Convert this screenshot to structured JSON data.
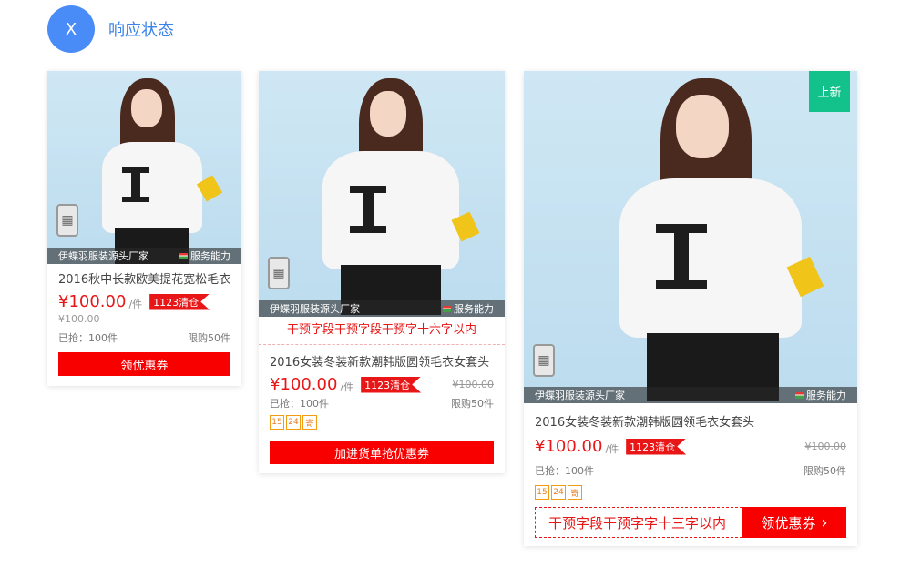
{
  "header": {
    "avatar_letter": "X",
    "title": "响应状态"
  },
  "shop": {
    "name": "伊蝶羽服装源头厂家",
    "service_label": "服务能力"
  },
  "cards": [
    {
      "product_name": "2016秋中长款欧美提花宽松毛衣",
      "price": "¥100.00",
      "unit": "/件",
      "stock_badge": "1123清仓",
      "old_price": "¥100.00",
      "sold": "已抢：100件",
      "limit": "限购50件",
      "coupon_button": "领优惠券"
    },
    {
      "notice": "干预字段干预字段干预字十六字以内",
      "product_name": "2016女装冬装新款潮韩版圆领毛衣女套头",
      "price": "¥100.00",
      "unit": "/件",
      "stock_badge": "1123清仓",
      "old_price": "¥100.00",
      "sold": "已抢：100件",
      "limit": "限购50件",
      "tags": [
        "15",
        "24",
        "寄"
      ],
      "cart_button": "加进货单抢优惠券"
    },
    {
      "ribbon": "上新",
      "product_name": "2016女装冬装新款潮韩版圆领毛衣女套头",
      "price": "¥100.00",
      "unit": "/件",
      "stock_badge": "1123清仓",
      "old_price": "¥100.00",
      "sold": "已抢：100件",
      "limit": "限购50件",
      "tags": [
        "15",
        "24",
        "寄"
      ],
      "combo_text": "干预字段干预字字十三字以内",
      "combo_button": "领优惠券",
      "combo_chevron": "›"
    }
  ]
}
